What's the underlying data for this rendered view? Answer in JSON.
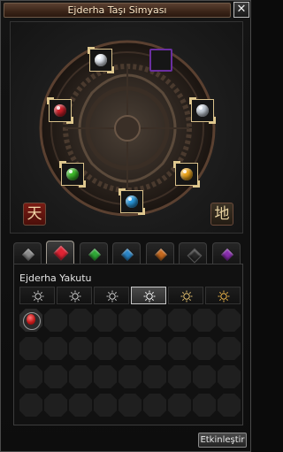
{
  "window": {
    "title": "Ejderha Taşı Simyası",
    "close_glyph": "✕"
  },
  "board": {
    "left_char": "天",
    "right_char": "地",
    "slots": [
      {
        "name": "white-gem-slot",
        "color": "#e8eef8"
      },
      {
        "name": "purple-empty-slot",
        "color": "#7a35b4"
      },
      {
        "name": "red-gem-slot",
        "color": "#d3202a"
      },
      {
        "name": "silver-gem-slot",
        "color": "#c9d2dc"
      },
      {
        "name": "green-gem-slot",
        "color": "#3fbf2b"
      },
      {
        "name": "yellow-gem-slot",
        "color": "#f2a91c"
      },
      {
        "name": "blue-gem-slot",
        "color": "#2a9be0"
      }
    ]
  },
  "tabs": [
    {
      "name": "gray-gem",
      "color": "#8c8c8c",
      "active": false
    },
    {
      "name": "red-gem",
      "color": "#e02434",
      "active": true
    },
    {
      "name": "green-gem",
      "color": "#2faa36",
      "active": false
    },
    {
      "name": "blue-gem",
      "color": "#2a86c8",
      "active": false
    },
    {
      "name": "orange-gem",
      "color": "#c86a1e",
      "active": false
    },
    {
      "name": "black-gem",
      "color": "#2a2a2a",
      "active": false
    },
    {
      "name": "purple-gem",
      "color": "#8a2db0",
      "active": false
    }
  ],
  "panel": {
    "section_title": "Ejderha Yakutu",
    "grades": [
      {
        "name": "grade-1",
        "active": false
      },
      {
        "name": "grade-2",
        "active": false
      },
      {
        "name": "grade-3",
        "active": false
      },
      {
        "name": "grade-4",
        "active": true
      },
      {
        "name": "grade-5",
        "active": false
      },
      {
        "name": "grade-6",
        "active": false
      }
    ],
    "grid_rows": 4,
    "grid_cols": 9,
    "filled_cells": [
      0
    ]
  },
  "actions": {
    "activate_label": "Etkinleştir"
  },
  "colors": {
    "title_bar": "#3a2418",
    "gold_frame": "#d8c08a"
  }
}
